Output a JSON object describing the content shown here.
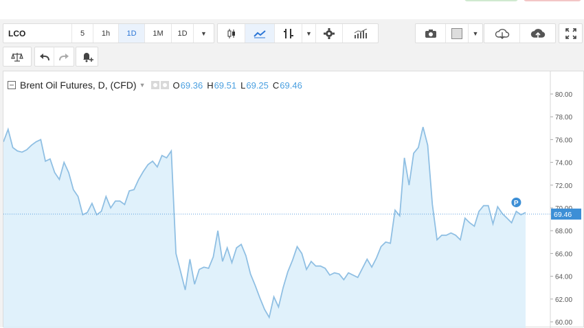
{
  "toolbar": {
    "symbol": "LCO",
    "intervals": [
      "5",
      "1h",
      "1D",
      "1M"
    ],
    "active_interval": "1D",
    "interval_dropdown": "1D"
  },
  "icons": [
    "candles-icon",
    "line-chart-icon",
    "indicators-icon",
    "chevron-down-icon",
    "gear-icon",
    "bar-chart-icon",
    "camera-icon",
    "color-swatch-icon",
    "cloud-download-icon",
    "cloud-upload-icon",
    "fullscreen-icon",
    "compare-icon",
    "undo-icon",
    "redo-icon",
    "alert-plus-icon"
  ],
  "legend": {
    "title": "Brent Oil Futures, D, (CFD)",
    "open_label": "O",
    "open": "69.36",
    "high_label": "H",
    "high": "69.51",
    "low_label": "L",
    "low": "69.25",
    "close_label": "C",
    "close": "69.46"
  },
  "price_label": "69.46",
  "marker_label": "P",
  "colors": {
    "line": "#8fbfe3",
    "fill": "#dbeefa",
    "accent": "#2a75d6",
    "price_tag": "#3d8fd6"
  },
  "chart_data": {
    "type": "area",
    "y_ticks": [
      "80.00",
      "78.00",
      "76.00",
      "74.00",
      "72.00",
      "70.00",
      "68.00",
      "66.00",
      "64.00",
      "62.00",
      "60.00"
    ],
    "ylim": [
      59.4,
      80.7
    ],
    "last_value": 69.46,
    "values": [
      75.8,
      76.9,
      75.3,
      75.0,
      74.9,
      75.1,
      75.5,
      75.8,
      76.0,
      74.1,
      74.3,
      73.1,
      72.5,
      74.0,
      73.1,
      71.6,
      71.0,
      69.4,
      69.6,
      70.4,
      69.4,
      69.7,
      71.0,
      70.0,
      70.6,
      70.6,
      70.3,
      71.5,
      71.6,
      72.5,
      73.2,
      73.8,
      74.1,
      73.6,
      74.6,
      74.4,
      75.0,
      66.0,
      64.4,
      62.8,
      65.5,
      63.3,
      64.6,
      64.8,
      64.7,
      65.7,
      68.0,
      65.3,
      66.5,
      65.2,
      66.5,
      66.8,
      65.8,
      64.2,
      63.2,
      62.1,
      61.1,
      60.4,
      62.2,
      61.3,
      63.0,
      64.4,
      65.4,
      66.6,
      66.0,
      64.6,
      65.3,
      64.9,
      64.9,
      64.7,
      64.1,
      64.3,
      64.2,
      63.7,
      64.3,
      64.1,
      63.9,
      64.7,
      65.5,
      64.8,
      65.6,
      66.6,
      67.0,
      66.9,
      69.8,
      69.3,
      74.4,
      72.0,
      74.8,
      75.3,
      77.1,
      75.5,
      70.3,
      67.2,
      67.6,
      67.6,
      67.8,
      67.6,
      67.2,
      69.1,
      68.7,
      68.4,
      69.7,
      70.2,
      70.2,
      68.6,
      70.1,
      69.5,
      69.1,
      68.7,
      69.7,
      69.4,
      69.6
    ]
  }
}
